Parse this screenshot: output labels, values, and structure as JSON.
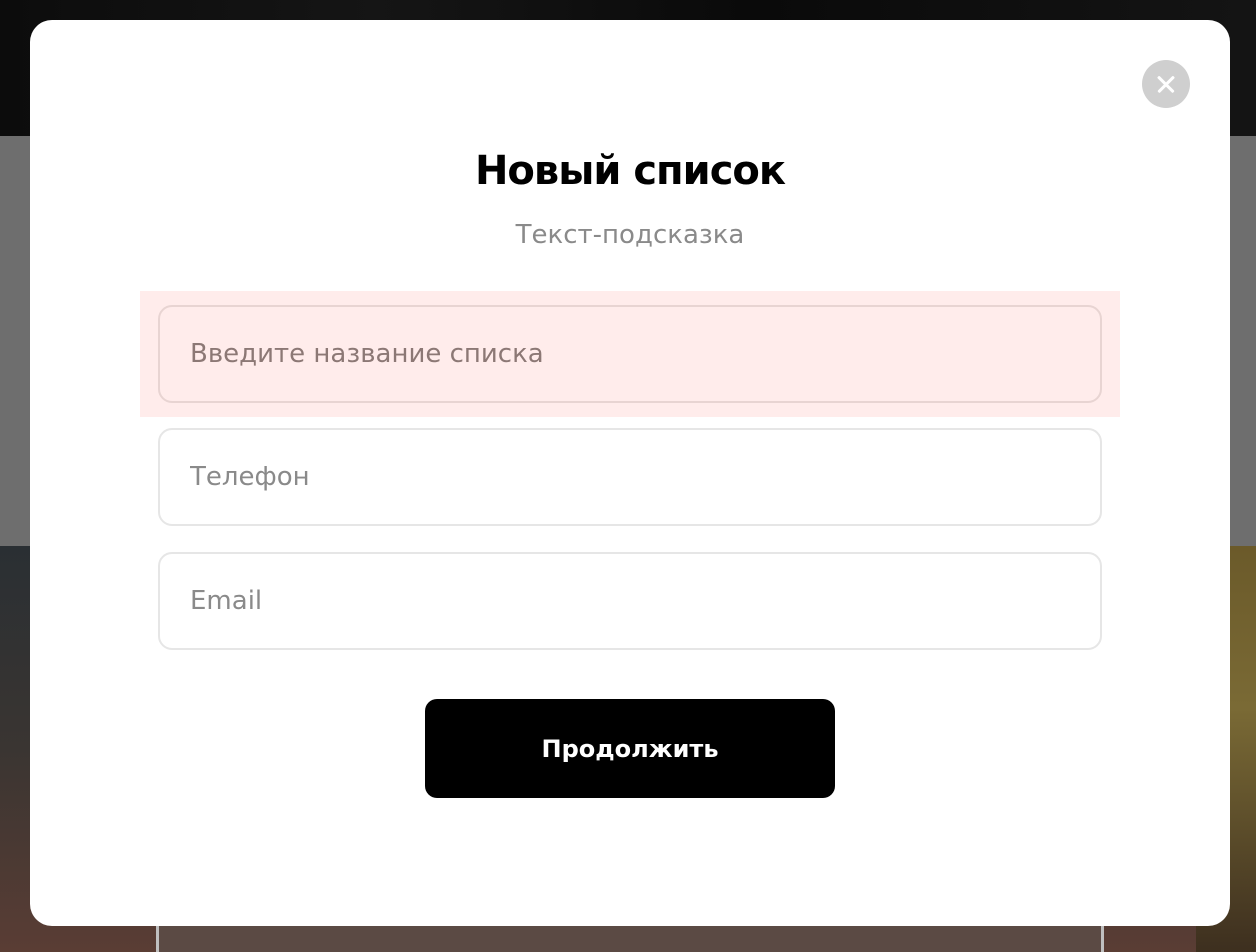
{
  "modal": {
    "title": "Новый список",
    "subtitle": "Текст-подсказка",
    "fields": {
      "list_name": {
        "placeholder": "Введите название списка",
        "value": "",
        "state": "error"
      },
      "phone": {
        "placeholder": "Телефон",
        "value": ""
      },
      "email": {
        "placeholder": "Email",
        "value": ""
      }
    },
    "submit_label": "Продолжить",
    "close_icon": "close-icon"
  },
  "colors": {
    "error_background": "#ffeceb",
    "button_background": "#000000",
    "close_button": "#cfcfcf",
    "hint_text": "#8a8a8a"
  }
}
